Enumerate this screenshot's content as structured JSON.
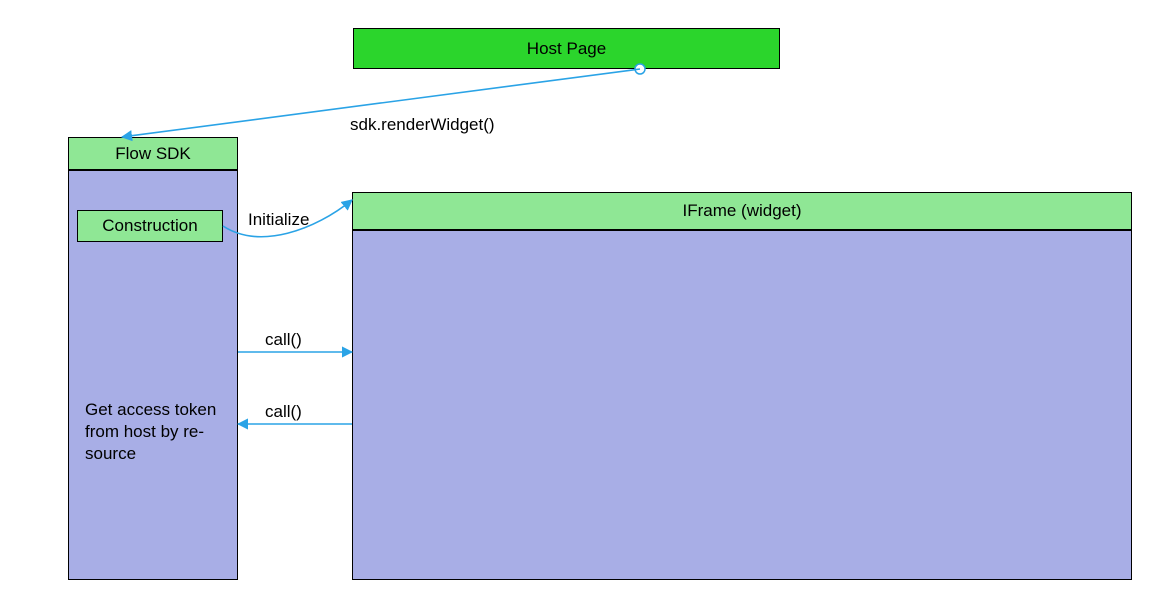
{
  "nodes": {
    "host_page": "Host Page",
    "flow_sdk": "Flow SDK",
    "construction": "Construction",
    "iframe_widget": "IFrame (widget)",
    "get_token": "Get access token from host by re­source"
  },
  "edges": {
    "render_widget": "sdk.renderWidget()",
    "initialize": "Initialize",
    "call_fwd": "call()",
    "call_back": "call()"
  },
  "colors": {
    "bright_green": "#2bd52c",
    "pale_green": "#8fe795",
    "lavender": "#a8aee6",
    "arrow": "#2aa3e6"
  }
}
